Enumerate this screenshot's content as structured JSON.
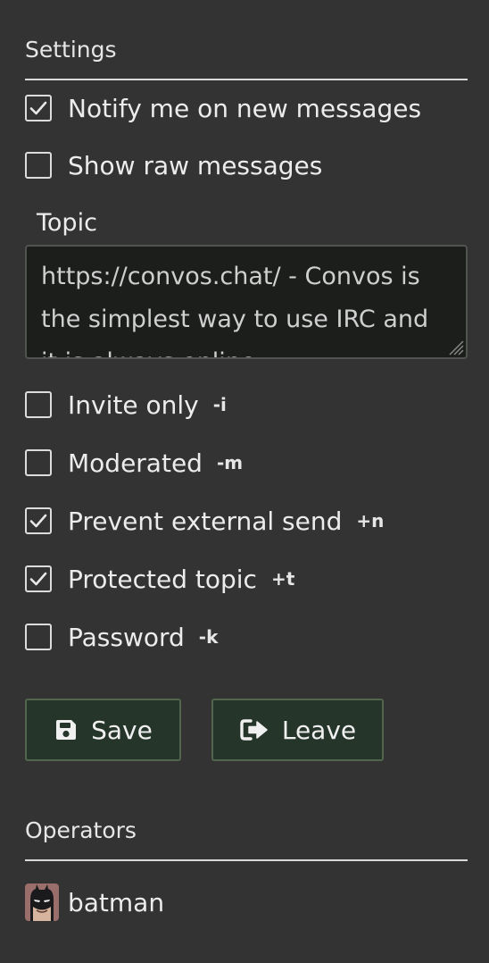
{
  "settings": {
    "title": "Settings",
    "notify": {
      "label": "Notify me on new messages",
      "checked": true
    },
    "raw": {
      "label": "Show raw messages",
      "checked": false
    },
    "topic": {
      "label": "Topic",
      "value": "https://convos.chat/ - Convos is the simplest way to use IRC and it is always online."
    },
    "modes": [
      {
        "label": "Invite only",
        "flag": "-i",
        "checked": false
      },
      {
        "label": "Moderated",
        "flag": "-m",
        "checked": false
      },
      {
        "label": "Prevent external send",
        "flag": "+n",
        "checked": true
      },
      {
        "label": "Protected topic",
        "flag": "+t",
        "checked": true
      },
      {
        "label": "Password",
        "flag": "-k",
        "checked": false
      }
    ],
    "save_label": "Save",
    "leave_label": "Leave"
  },
  "operators": {
    "title": "Operators",
    "items": [
      {
        "name": "batman",
        "avatar_icon": "batman-avatar-icon"
      }
    ]
  },
  "colors": {
    "background": "#333333",
    "button_bg": "#26352a",
    "button_border": "#52664e",
    "topic_bg": "#1c1e1c"
  }
}
